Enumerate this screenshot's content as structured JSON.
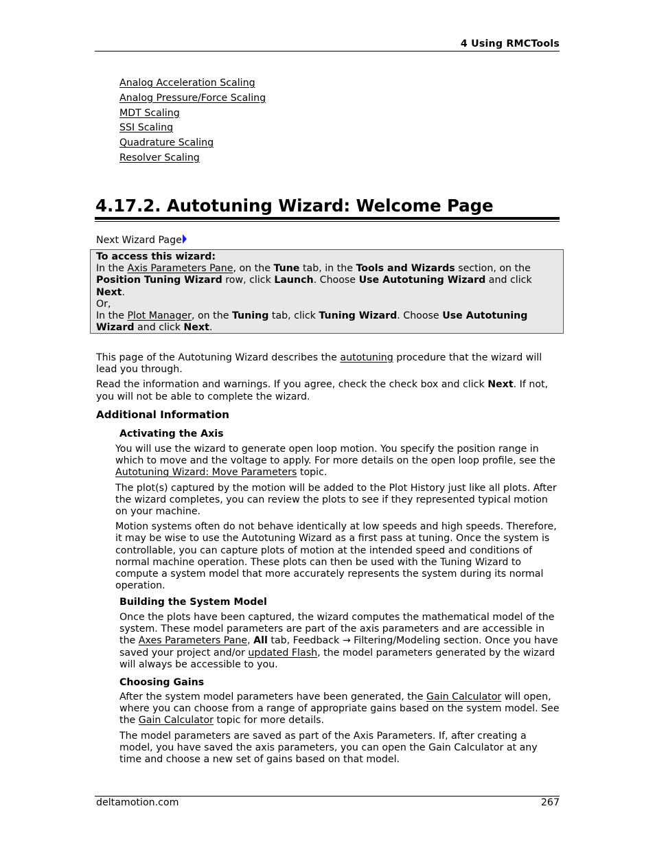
{
  "header": {
    "chapter": "4  Using RMCTools"
  },
  "see_also_links": [
    "Analog Acceleration Scaling",
    "Analog Pressure/Force Scaling",
    "MDT Scaling",
    "SSI Scaling",
    "Quadrature Scaling",
    "Resolver Scaling"
  ],
  "section": {
    "title": "4.17.2. Autotuning Wizard: Welcome Page",
    "next_wizard_page": "Next Wizard Page",
    "next_icon": "right-arrow-icon"
  },
  "access_box": {
    "heading": "To access this wizard:",
    "l1_a": "In the ",
    "l1_link": "Axis Parameters Pane",
    "l1_b": ", on the ",
    "l1_tune": "Tune",
    "l1_c": " tab, in the ",
    "l1_tools": "Tools and Wizards",
    "l1_d": " section, on the ",
    "l1_row": "Position Tuning Wizard",
    "l1_e": " row, click ",
    "l1_launch": "Launch",
    "l1_f": ". Choose ",
    "l1_use": "Use Autotuning Wizard",
    "l1_g": " and click ",
    "l1_next": "Next",
    "l1_h": ".",
    "or": "Or,",
    "l2_a": "In the ",
    "l2_link": "Plot Manager",
    "l2_b": ", on the ",
    "l2_tuning": "Tuning",
    "l2_c": " tab, click ",
    "l2_wizard": "Tuning Wizard",
    "l2_d": ". Choose ",
    "l2_use": "Use Autotuning Wizard",
    "l2_e": " and click ",
    "l2_next": "Next",
    "l2_f": "."
  },
  "intro": {
    "p1_a": "This page of the Autotuning Wizard describes the ",
    "p1_link": "autotuning",
    "p1_b": " procedure that the wizard will lead you through.",
    "p2_a": "Read the information and warnings. If you agree, check the check box and click ",
    "p2_next": "Next",
    "p2_b": ". If not, you will not be able to complete the wizard."
  },
  "additional": {
    "heading": "Additional Information",
    "activating": {
      "heading": "Activating the Axis",
      "p1_a": "You will use the wizard to generate open loop motion. You specify the position range in which to move and the voltage to apply. For more details on the open loop profile, see the ",
      "p1_link": "Autotuning Wizard: Move Parameters",
      "p1_b": " topic.",
      "p2": "The plot(s) captured by the motion will be added to the Plot History just like all plots. After the wizard completes, you can review the plots to see if they represented typical motion on your machine.",
      "p3": "Motion systems often do not behave identically at low speeds and high speeds. Therefore, it may be wise to use the Autotuning Wizard as a first pass at tuning. Once the system is controllable, you can capture plots of motion at the intended speed and conditions of normal machine operation. These plots can then be used with the Tuning Wizard to compute a system model that more accurately represents the system during its normal operation."
    },
    "building": {
      "heading": "Building the System Model",
      "p1_a": "Once the plots have been captured, the wizard computes the mathematical model of the system. These model parameters are part of the axis parameters and are accessible in the ",
      "p1_link1": "Axes Parameters Pane",
      "p1_b": ", ",
      "p1_all": "All",
      "p1_c": " tab, Feedback → Filtering/Modeling section. Once you have saved your project and/or ",
      "p1_link2": "updated Flash",
      "p1_d": ", the model parameters generated by the wizard will always be accessible to you."
    },
    "choosing": {
      "heading": "Choosing Gains",
      "p1_a": "After the system model parameters have been generated, the ",
      "p1_link1": "Gain Calculator",
      "p1_b": " will open, where you can choose from a range of appropriate gains based on the system model. See the ",
      "p1_link2": "Gain Calculator",
      "p1_c": " topic for more details.",
      "p2": "The model parameters are saved as part of the Axis Parameters. If, after creating a model, you have saved the axis parameters, you can open the Gain Calculator at any time and choose a new set of gains based on that model."
    }
  },
  "footer": {
    "site": "deltamotion.com",
    "page_number": "267"
  }
}
